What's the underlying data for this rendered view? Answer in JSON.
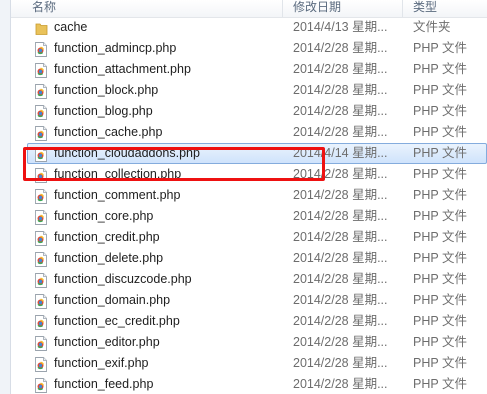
{
  "columns": {
    "name": "名称",
    "date": "修改日期",
    "type": "类型"
  },
  "colors": {
    "accent": "#cfe3fc",
    "highlight": "#ee1111",
    "folder": "#e9c25a"
  },
  "highlighted_index": 6,
  "files": [
    {
      "name": "cache",
      "date": "2014/4/13 星期...",
      "type": "文件夹",
      "icon": "folder-icon"
    },
    {
      "name": "function_admincp.php",
      "date": "2014/2/28 星期...",
      "type": "PHP 文件",
      "icon": "php-file-icon"
    },
    {
      "name": "function_attachment.php",
      "date": "2014/2/28 星期...",
      "type": "PHP 文件",
      "icon": "php-file-icon"
    },
    {
      "name": "function_block.php",
      "date": "2014/2/28 星期...",
      "type": "PHP 文件",
      "icon": "php-file-icon"
    },
    {
      "name": "function_blog.php",
      "date": "2014/2/28 星期...",
      "type": "PHP 文件",
      "icon": "php-file-icon"
    },
    {
      "name": "function_cache.php",
      "date": "2014/2/28 星期...",
      "type": "PHP 文件",
      "icon": "php-file-icon"
    },
    {
      "name": "function_cloudaddons.php",
      "date": "2014/4/14 星期...",
      "type": "PHP 文件",
      "icon": "php-file-icon"
    },
    {
      "name": "function_collection.php",
      "date": "2014/2/28 星期...",
      "type": "PHP 文件",
      "icon": "php-file-icon"
    },
    {
      "name": "function_comment.php",
      "date": "2014/2/28 星期...",
      "type": "PHP 文件",
      "icon": "php-file-icon"
    },
    {
      "name": "function_core.php",
      "date": "2014/2/28 星期...",
      "type": "PHP 文件",
      "icon": "php-file-icon"
    },
    {
      "name": "function_credit.php",
      "date": "2014/2/28 星期...",
      "type": "PHP 文件",
      "icon": "php-file-icon"
    },
    {
      "name": "function_delete.php",
      "date": "2014/2/28 星期...",
      "type": "PHP 文件",
      "icon": "php-file-icon"
    },
    {
      "name": "function_discuzcode.php",
      "date": "2014/2/28 星期...",
      "type": "PHP 文件",
      "icon": "php-file-icon"
    },
    {
      "name": "function_domain.php",
      "date": "2014/2/28 星期...",
      "type": "PHP 文件",
      "icon": "php-file-icon"
    },
    {
      "name": "function_ec_credit.php",
      "date": "2014/2/28 星期...",
      "type": "PHP 文件",
      "icon": "php-file-icon"
    },
    {
      "name": "function_editor.php",
      "date": "2014/2/28 星期...",
      "type": "PHP 文件",
      "icon": "php-file-icon"
    },
    {
      "name": "function_exif.php",
      "date": "2014/2/28 星期...",
      "type": "PHP 文件",
      "icon": "php-file-icon"
    },
    {
      "name": "function_feed.php",
      "date": "2014/2/28 星期...",
      "type": "PHP 文件",
      "icon": "php-file-icon"
    }
  ]
}
